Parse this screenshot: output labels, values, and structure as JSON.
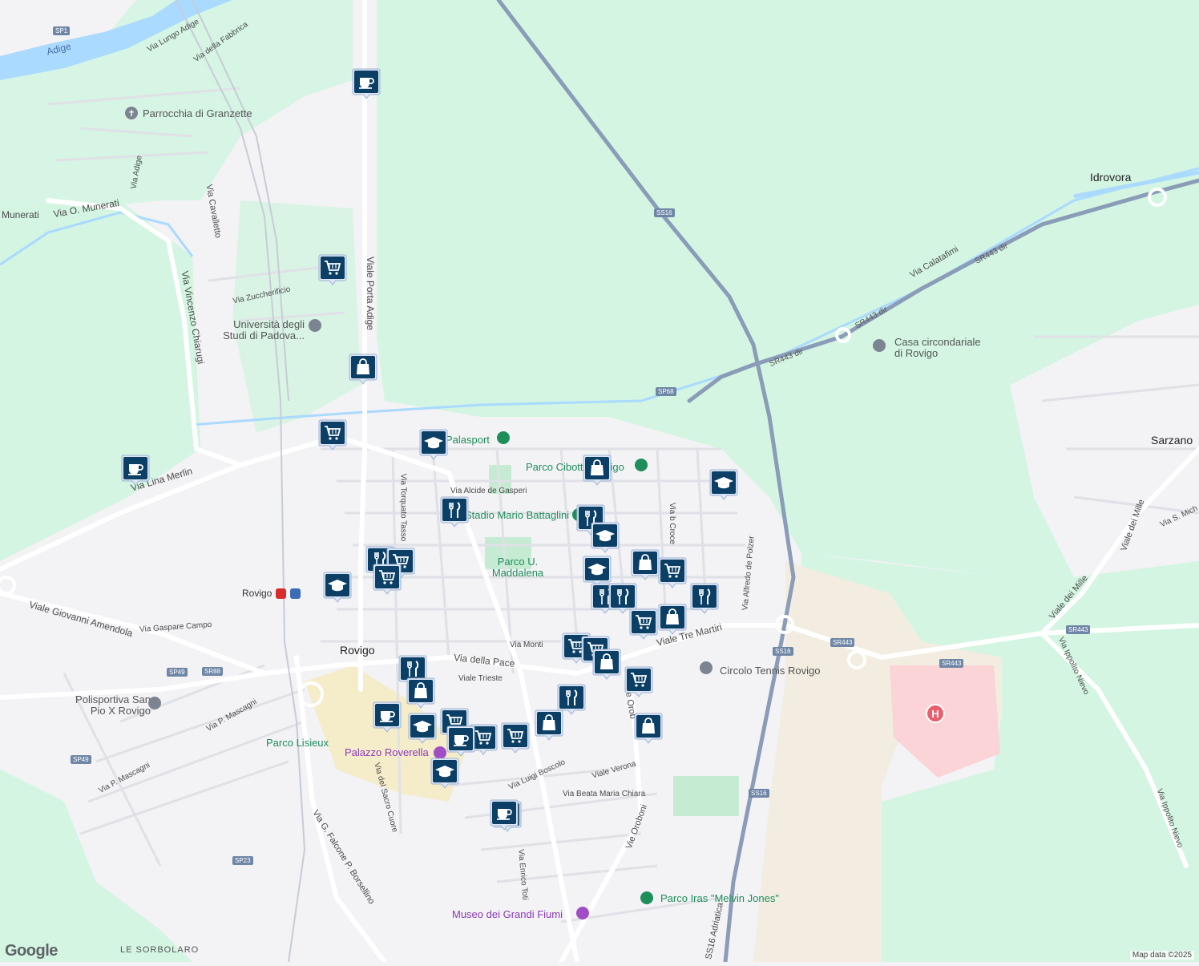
{
  "map": {
    "attribution": "Map data ©2025",
    "logo": "Google",
    "colors": {
      "land": "#f3f2f5",
      "green": "#d3f5e2",
      "water": "#aadaff",
      "highway": "#8a9cb7",
      "hospital": "#fad4d7"
    }
  },
  "labels": {
    "rovigo": "Rovigo",
    "idrovora": "Idrovora",
    "sarzano": "Sarzano",
    "le_sorbolaro": "LE SORBOLARO",
    "adige": "Adige",
    "parrocchia": "Parrocchia di Granzette",
    "universita": "Università degli Studi di Padova...",
    "casa_circ": "Casa circondariale di Rovigo",
    "palasport": "Palasport",
    "parco_cibotto": "Parco Cibotto Rovigo",
    "stadio": "Stadio Mario Battaglini",
    "parco_maddalena": "Parco U. Maddalena",
    "rovigo_station": "Rovigo",
    "polisportiva": "Polisportiva San Pio X Rovigo",
    "parco_lisieux": "Parco Lisieux",
    "palazzo_roverella": "Palazzo Roverella",
    "circolo_tennis": "Circolo Tennis Rovigo",
    "parco_iras": "Parco Iras \"Melvin Jones\"",
    "museo": "Museo dei Grandi Fiumi",
    "via_lungo_adige": "Via Lungo Adige",
    "via_fabbrica": "Via della Fabbrica",
    "via_adige": "Via Adige",
    "munerati": "Munerati",
    "via_o_munerati": "Via O. Munerati",
    "via_cavalletto": "Via Cavalletto",
    "via_zuccherificio": "Via Zuccherificio",
    "via_vincenzo_chiarugi": "Via Vincenzo Chiarugi",
    "viale_porta_adige": "Viale Porta Adige",
    "via_lina_merlin": "Via Lina Merlin",
    "via_torquato_tasso": "Via Torquato Tasso",
    "via_alcide": "Via Alcide de Gasperi",
    "via_croce": "Via b Croce",
    "via_alfredo": "Via Alfredo de Polzer",
    "viale_amendola": "Viale Giovanni Amendola",
    "via_gaspare": "Via Gaspare Campo",
    "via_monti": "Via Monti",
    "via_pace": "Via della Pace",
    "viale_trieste": "Viale Trieste",
    "viale_tre_martiri": "Viale Tre Martiri",
    "via_mascagni": "Via P. Mascagni",
    "via_sacro_cuore": "Via del Sacro Cuore",
    "via_boscolo": "Via Luigi Boscolo",
    "viale_verona": "Viale Verona",
    "via_beata": "Via Beata Maria Chiara",
    "vie_oroboni": "Vie Oroboni",
    "vie_orob2": "Vie Orob",
    "via_enrico_toti": "Via Enrico Toti",
    "via_falcone": "Via G. Falcone P. Borsellino",
    "via_calatafimi": "Via Calatafimi",
    "viale_mille": "Viale dei Mille",
    "via_ippolito": "Via Ippolito Nievo",
    "via_ippolito2": "Via Ippolito Nievo",
    "via_s_mich": "Via S. Mich",
    "ss16_adriatica": "SS16 Adriatica"
  },
  "shields": {
    "sp1": "SP1",
    "ss16a": "SS16",
    "sp68": "SP68",
    "sr443dir1": "SR443 dir",
    "sr443dir2": "SR443 dir",
    "sr443dir3": "SR443 dir",
    "ss16b": "SS16",
    "sr443a": "SR443",
    "sr443b": "SR443",
    "sr443c": "SR443",
    "ss16c": "SS16",
    "sp49a": "SP49",
    "sr88": "SR88",
    "sp49b": "SP49",
    "sp23": "SP23"
  },
  "pois": [
    {
      "type": "cafe-icon"
    },
    {
      "type": "cart-icon"
    },
    {
      "type": "bag-icon"
    },
    {
      "type": "cart-icon"
    },
    {
      "type": "school-icon"
    },
    {
      "type": "cafe-icon"
    },
    {
      "type": "bag-icon"
    },
    {
      "type": "school-icon"
    },
    {
      "type": "restaurant-icon"
    },
    {
      "type": "restaurant-icon"
    },
    {
      "type": "school-icon"
    },
    {
      "type": "restaurant-icon"
    },
    {
      "type": "cart-icon"
    },
    {
      "type": "cart-icon"
    },
    {
      "type": "school-icon"
    },
    {
      "type": "school-icon"
    },
    {
      "type": "bag-icon"
    },
    {
      "type": "cart-icon"
    },
    {
      "type": "restaurant-icon"
    },
    {
      "type": "restaurant-icon"
    },
    {
      "type": "restaurant-icon"
    },
    {
      "type": "cart-icon"
    },
    {
      "type": "bag-icon"
    },
    {
      "type": "cart-icon"
    },
    {
      "type": "cart-icon"
    },
    {
      "type": "bag-icon"
    },
    {
      "type": "cart-icon"
    },
    {
      "type": "restaurant-icon"
    },
    {
      "type": "restaurant-icon"
    },
    {
      "type": "bag-icon"
    },
    {
      "type": "cafe-icon"
    },
    {
      "type": "school-icon"
    },
    {
      "type": "cart-icon"
    },
    {
      "type": "cart-icon"
    },
    {
      "type": "cafe-icon"
    },
    {
      "type": "cart-icon"
    },
    {
      "type": "school-icon"
    },
    {
      "type": "bag-icon"
    },
    {
      "type": "bag-icon"
    },
    {
      "type": "school-icon"
    },
    {
      "type": "cafe-icon"
    }
  ]
}
